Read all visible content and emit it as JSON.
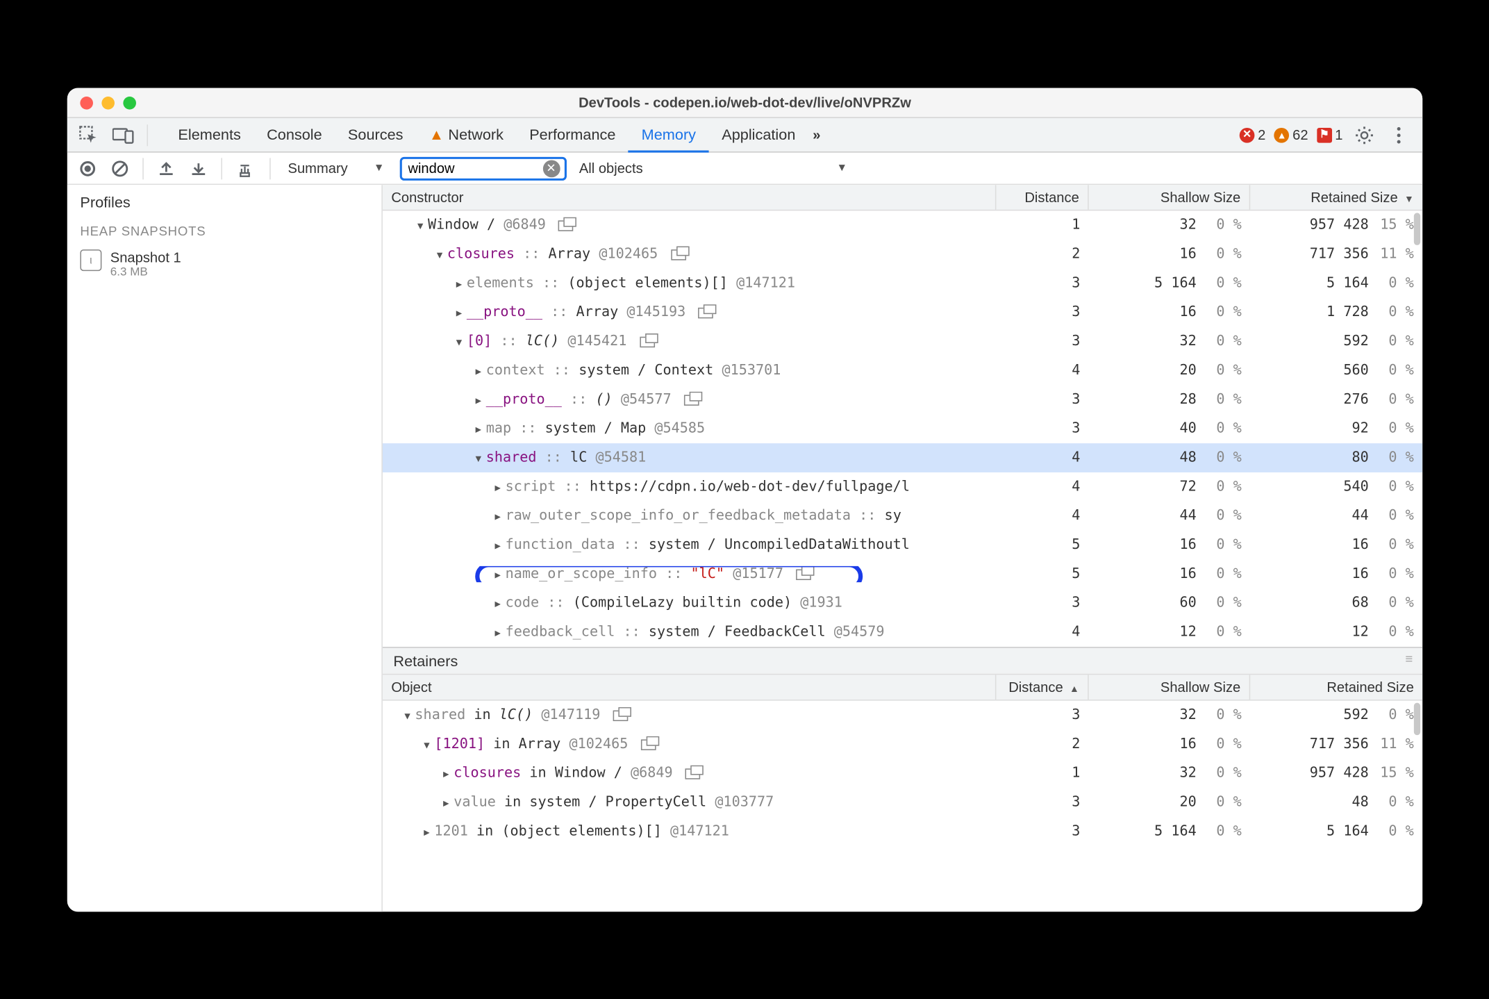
{
  "title": "DevTools - codepen.io/web-dot-dev/live/oNVPRZw",
  "tabs": [
    "Elements",
    "Console",
    "Sources",
    "Network",
    "Performance",
    "Memory",
    "Application"
  ],
  "tabs_overflow": "»",
  "active_tab": "Memory",
  "network_warn": true,
  "status": {
    "errors": 2,
    "warnings": 62,
    "issues": 1
  },
  "toolbar": {
    "summary_label": "Summary",
    "filter_value": "window",
    "objects_label": "All objects"
  },
  "sidebar": {
    "profiles_label": "Profiles",
    "group_label": "HEAP SNAPSHOTS",
    "snapshot": {
      "name": "Snapshot 1",
      "size": "6.3 MB"
    }
  },
  "columns": {
    "constructor": "Constructor",
    "distance": "Distance",
    "shallow": "Shallow Size",
    "retained": "Retained Size"
  },
  "rows": [
    {
      "indent": 0,
      "expand": "open",
      "label_html": "Window /  <span class='k-id'>@6849</span> <span class='popout'></span>",
      "dist": "1",
      "sh": "32",
      "shp": "0 %",
      "rt": "957 428",
      "rtp": "15 %"
    },
    {
      "indent": 1,
      "expand": "open",
      "label_html": "<span class='k-prop'>closures</span> <span class='k-sep'>::</span> Array <span class='k-id'>@102465</span> <span class='popout'></span>",
      "dist": "2",
      "sh": "16",
      "shp": "0 %",
      "rt": "717 356",
      "rtp": "11 %"
    },
    {
      "indent": 2,
      "expand": "closed",
      "label_html": "<span class='k-dim'>elements</span> <span class='k-sep'>::</span> (object elements)[] <span class='k-id'>@147121</span>",
      "dist": "3",
      "sh": "5 164",
      "shp": "0 %",
      "rt": "5 164",
      "rtp": "0 %"
    },
    {
      "indent": 2,
      "expand": "closed",
      "label_html": "<span class='k-prop'>__proto__</span> <span class='k-sep'>::</span> Array <span class='k-id'>@145193</span> <span class='popout'></span>",
      "dist": "3",
      "sh": "16",
      "shp": "0 %",
      "rt": "1 728",
      "rtp": "0 %"
    },
    {
      "indent": 2,
      "expand": "open",
      "label_html": "<span class='k-prop'>[0]</span> <span class='k-sep'>::</span> <i>lC()</i> <span class='k-id'>@145421</span> <span class='popout'></span>",
      "dist": "3",
      "sh": "32",
      "shp": "0 %",
      "rt": "592",
      "rtp": "0 %"
    },
    {
      "indent": 3,
      "expand": "closed",
      "label_html": "<span class='k-dim'>context</span> <span class='k-sep'>::</span> system / Context <span class='k-id'>@153701</span>",
      "dist": "4",
      "sh": "20",
      "shp": "0 %",
      "rt": "560",
      "rtp": "0 %"
    },
    {
      "indent": 3,
      "expand": "closed",
      "label_html": "<span class='k-prop'>__proto__</span> <span class='k-sep'>::</span> <i>()</i> <span class='k-id'>@54577</span> <span class='popout'></span>",
      "dist": "3",
      "sh": "28",
      "shp": "0 %",
      "rt": "276",
      "rtp": "0 %"
    },
    {
      "indent": 3,
      "expand": "closed",
      "label_html": "<span class='k-dim'>map</span> <span class='k-sep'>::</span> system / Map <span class='k-id'>@54585</span>",
      "dist": "3",
      "sh": "40",
      "shp": "0 %",
      "rt": "92",
      "rtp": "0 %"
    },
    {
      "indent": 3,
      "expand": "open",
      "label_html": "<span class='k-prop'>shared</span> <span class='k-sep'>::</span> lC <span class='k-id'>@54581</span>",
      "dist": "4",
      "sh": "48",
      "shp": "0 %",
      "rt": "80",
      "rtp": "0 %",
      "selected": true
    },
    {
      "indent": 4,
      "expand": "closed",
      "label_html": "<span class='k-dim'>script</span> <span class='k-sep'>::</span> https://cdpn.io/web-dot-dev/fullpage/l",
      "dist": "4",
      "sh": "72",
      "shp": "0 %",
      "rt": "540",
      "rtp": "0 %"
    },
    {
      "indent": 4,
      "expand": "closed",
      "label_html": "<span class='k-dim'>raw_outer_scope_info_or_feedback_metadata</span> <span class='k-sep'>::</span> sy",
      "dist": "4",
      "sh": "44",
      "shp": "0 %",
      "rt": "44",
      "rtp": "0 %"
    },
    {
      "indent": 4,
      "expand": "closed",
      "label_html": "<span class='k-dim'>function_data</span> <span class='k-sep'>::</span> system / UncompiledDataWithoutl",
      "dist": "5",
      "sh": "16",
      "shp": "0 %",
      "rt": "16",
      "rtp": "0 %"
    },
    {
      "indent": 4,
      "expand": "closed",
      "label_html": "<span class='k-dim'>name_or_scope_info</span> <span class='k-sep'>::</span> <span class='k-str'>\"lC\"</span> <span class='k-id'>@15177</span> <span class='popout'></span>",
      "dist": "5",
      "sh": "16",
      "shp": "0 %",
      "rt": "16",
      "rtp": "0 %",
      "ring": true
    },
    {
      "indent": 4,
      "expand": "closed",
      "label_html": "<span class='k-dim'>code</span> <span class='k-sep'>::</span> (CompileLazy builtin code) <span class='k-id'>@1931</span>",
      "dist": "3",
      "sh": "60",
      "shp": "0 %",
      "rt": "68",
      "rtp": "0 %"
    },
    {
      "indent": 4,
      "expand": "closed",
      "label_html": "<span class='k-dim'>feedback_cell</span> <span class='k-sep'>::</span> system / FeedbackCell <span class='k-id'>@54579</span>",
      "dist": "4",
      "sh": "12",
      "shp": "0 %",
      "rt": "12",
      "rtp": "0 %"
    }
  ],
  "retainers": {
    "title": "Retainers",
    "columns": {
      "object": "Object",
      "distance": "Distance",
      "shallow": "Shallow Size",
      "retained": "Retained Size"
    },
    "rows": [
      {
        "indent": 0,
        "expand": "open",
        "label_html": "<span class='k-dim'>shared</span> in <i>lC()</i> <span class='k-id'>@147119</span> <span class='popout'></span>",
        "dist": "3",
        "sh": "32",
        "shp": "0 %",
        "rt": "592",
        "rtp": "0 %"
      },
      {
        "indent": 1,
        "expand": "open",
        "label_html": "<span class='k-prop'>[1201]</span> in Array <span class='k-id'>@102465</span> <span class='popout'></span>",
        "dist": "2",
        "sh": "16",
        "shp": "0 %",
        "rt": "717 356",
        "rtp": "11 %"
      },
      {
        "indent": 2,
        "expand": "closed",
        "label_html": "<span class='k-prop'>closures</span> in Window /  <span class='k-id'>@6849</span> <span class='popout'></span>",
        "dist": "1",
        "sh": "32",
        "shp": "0 %",
        "rt": "957 428",
        "rtp": "15 %"
      },
      {
        "indent": 2,
        "expand": "closed",
        "label_html": "<span class='k-dim'>value</span> in system / PropertyCell <span class='k-id'>@103777</span>",
        "dist": "3",
        "sh": "20",
        "shp": "0 %",
        "rt": "48",
        "rtp": "0 %"
      },
      {
        "indent": 1,
        "expand": "closed",
        "label_html": "<span class='k-dim'>1201</span> in (object elements)[] <span class='k-id'>@147121</span>",
        "dist": "3",
        "sh": "5 164",
        "shp": "0 %",
        "rt": "5 164",
        "rtp": "0 %"
      }
    ]
  }
}
